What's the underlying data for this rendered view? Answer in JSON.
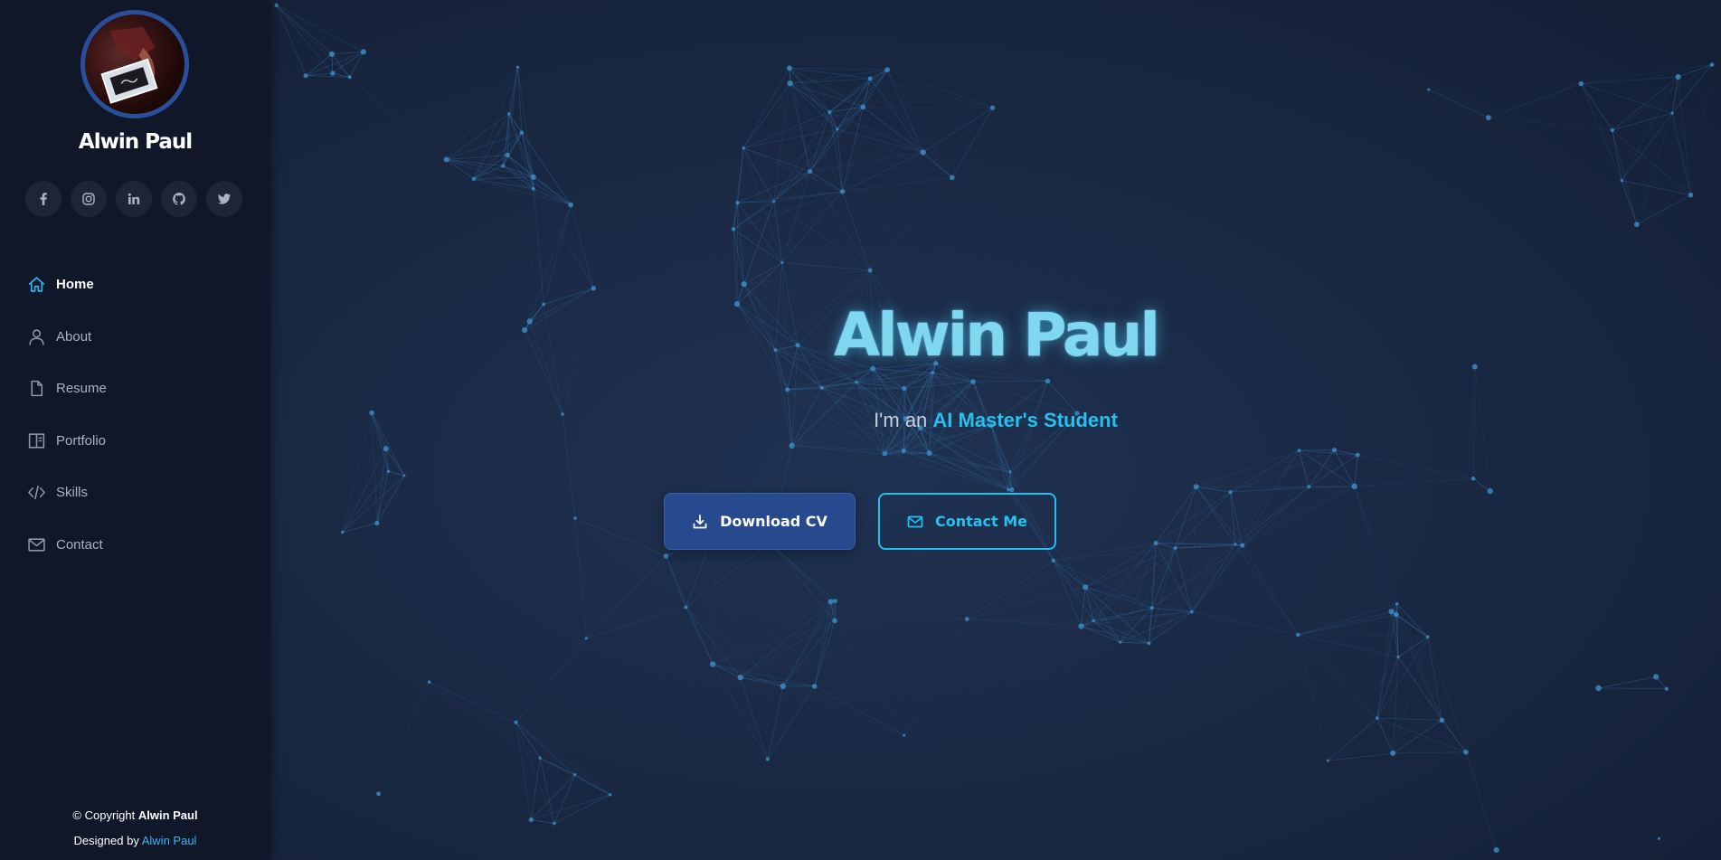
{
  "sidebar": {
    "name": "Alwin Paul",
    "socials": [
      {
        "name": "facebook-icon"
      },
      {
        "name": "instagram-icon"
      },
      {
        "name": "linkedin-icon"
      },
      {
        "name": "github-icon"
      },
      {
        "name": "twitter-icon"
      }
    ],
    "nav": [
      {
        "label": "Home",
        "icon": "home-icon",
        "active": true
      },
      {
        "label": "About",
        "icon": "user-icon",
        "active": false
      },
      {
        "label": "Resume",
        "icon": "file-icon",
        "active": false
      },
      {
        "label": "Portfolio",
        "icon": "book-icon",
        "active": false
      },
      {
        "label": "Skills",
        "icon": "code-icon",
        "active": false
      },
      {
        "label": "Contact",
        "icon": "envelope-icon",
        "active": false
      }
    ],
    "footer": {
      "copyright_prefix": "© Copyright",
      "copyright_name": "Alwin Paul",
      "designed_prefix": "Designed by",
      "designed_name": "Alwin Paul"
    }
  },
  "hero": {
    "title": "Alwin Paul",
    "subtitle_prefix": "I'm an",
    "subtitle_role": "AI Master's Student",
    "download_label": "Download CV",
    "contact_label": "Contact Me"
  },
  "colors": {
    "accent": "#27c1ee",
    "sidebar_bg": "#0f1729",
    "hero_bg": "#1a2944",
    "primary_button": "#27498e"
  }
}
